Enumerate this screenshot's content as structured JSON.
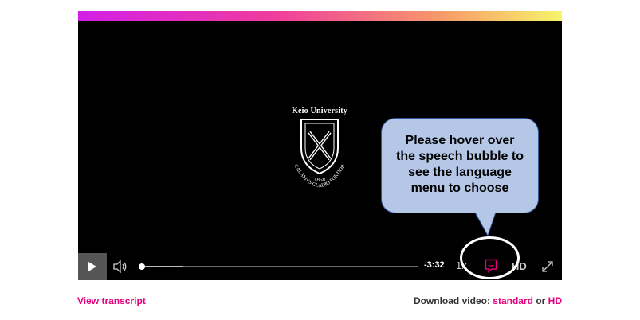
{
  "player": {
    "logo": {
      "title": "Keio University",
      "year": "1858",
      "motto": "CALAMVS GLADIO FORTIOR"
    },
    "controls": {
      "play_icon": "play-icon",
      "volume_icon": "volume-icon",
      "progress_fraction": 0.0,
      "time_remaining": "-3:32",
      "speed_label": "1x",
      "captions_icon": "speech-bubble-icon",
      "hd_label": "HD",
      "fullscreen_icon": "fullscreen-icon"
    }
  },
  "callout": {
    "lines": [
      "Please hover over",
      "the speech bubble to",
      "see the language",
      "menu to choose"
    ]
  },
  "footer": {
    "view_transcript": "View transcript",
    "download_prefix": "Download video:",
    "download_standard": "standard",
    "download_or": "or",
    "download_hd": "HD"
  },
  "colors": {
    "accent": "#e6007e",
    "gradient": [
      "#d21fe8",
      "#f04a8a",
      "#f7a05a",
      "#f6f46a"
    ],
    "callout_fill": "#b4c7e7",
    "callout_border": "#2f5597"
  }
}
